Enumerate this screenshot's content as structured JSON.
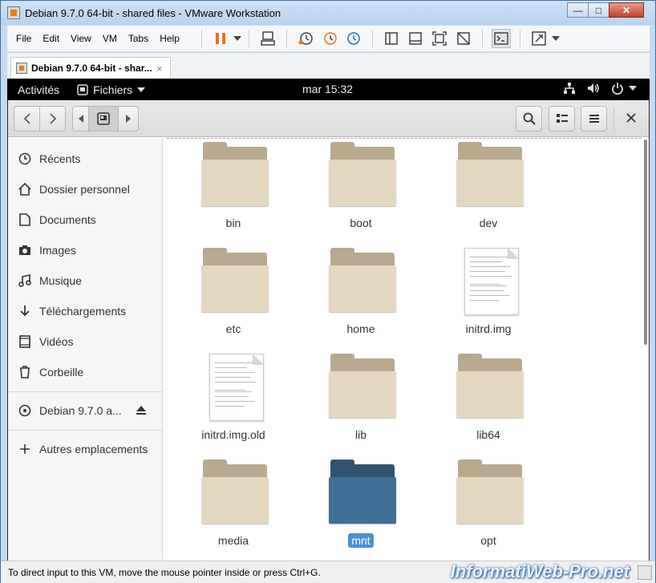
{
  "window": {
    "title": "Debian 9.7.0 64-bit - shared files - VMware Workstation"
  },
  "menu": [
    "File",
    "Edit",
    "View",
    "VM",
    "Tabs",
    "Help"
  ],
  "tab": {
    "label": "Debian 9.7.0 64-bit - shar...",
    "close": "×"
  },
  "gnome": {
    "activities": "Activités",
    "app_menu": "Fichiers",
    "clock": "mar 15:32"
  },
  "sidebar": {
    "items": [
      {
        "label": "Récents",
        "icon": "clock-icon"
      },
      {
        "label": "Dossier personnel",
        "icon": "home-icon"
      },
      {
        "label": "Documents",
        "icon": "document-icon"
      },
      {
        "label": "Images",
        "icon": "camera-icon"
      },
      {
        "label": "Musique",
        "icon": "music-icon"
      },
      {
        "label": "Téléchargements",
        "icon": "download-icon"
      },
      {
        "label": "Vidéos",
        "icon": "video-icon"
      },
      {
        "label": "Corbeille",
        "icon": "trash-icon"
      }
    ],
    "device": {
      "label": "Debian 9.7.0 a...",
      "icon": "disc-icon"
    },
    "other": {
      "label": "Autres emplacements",
      "icon": "plus-icon"
    }
  },
  "files": [
    {
      "name": "bin",
      "type": "folder"
    },
    {
      "name": "boot",
      "type": "folder"
    },
    {
      "name": "dev",
      "type": "folder"
    },
    {
      "name": "etc",
      "type": "folder"
    },
    {
      "name": "home",
      "type": "folder"
    },
    {
      "name": "initrd.img",
      "type": "file"
    },
    {
      "name": "initrd.img.old",
      "type": "file"
    },
    {
      "name": "lib",
      "type": "folder"
    },
    {
      "name": "lib64",
      "type": "folder"
    },
    {
      "name": "media",
      "type": "folder"
    },
    {
      "name": "mnt",
      "type": "folder",
      "selected": true
    },
    {
      "name": "opt",
      "type": "folder"
    }
  ],
  "status": {
    "text": "To direct input to this VM, move the mouse pointer inside or press Ctrl+G."
  },
  "watermark": "InformatiWeb-Pro.net",
  "colors": {
    "accent": "#4a90d9",
    "folder": "#e5d8c1",
    "selected_folder": "#3e6f96"
  }
}
